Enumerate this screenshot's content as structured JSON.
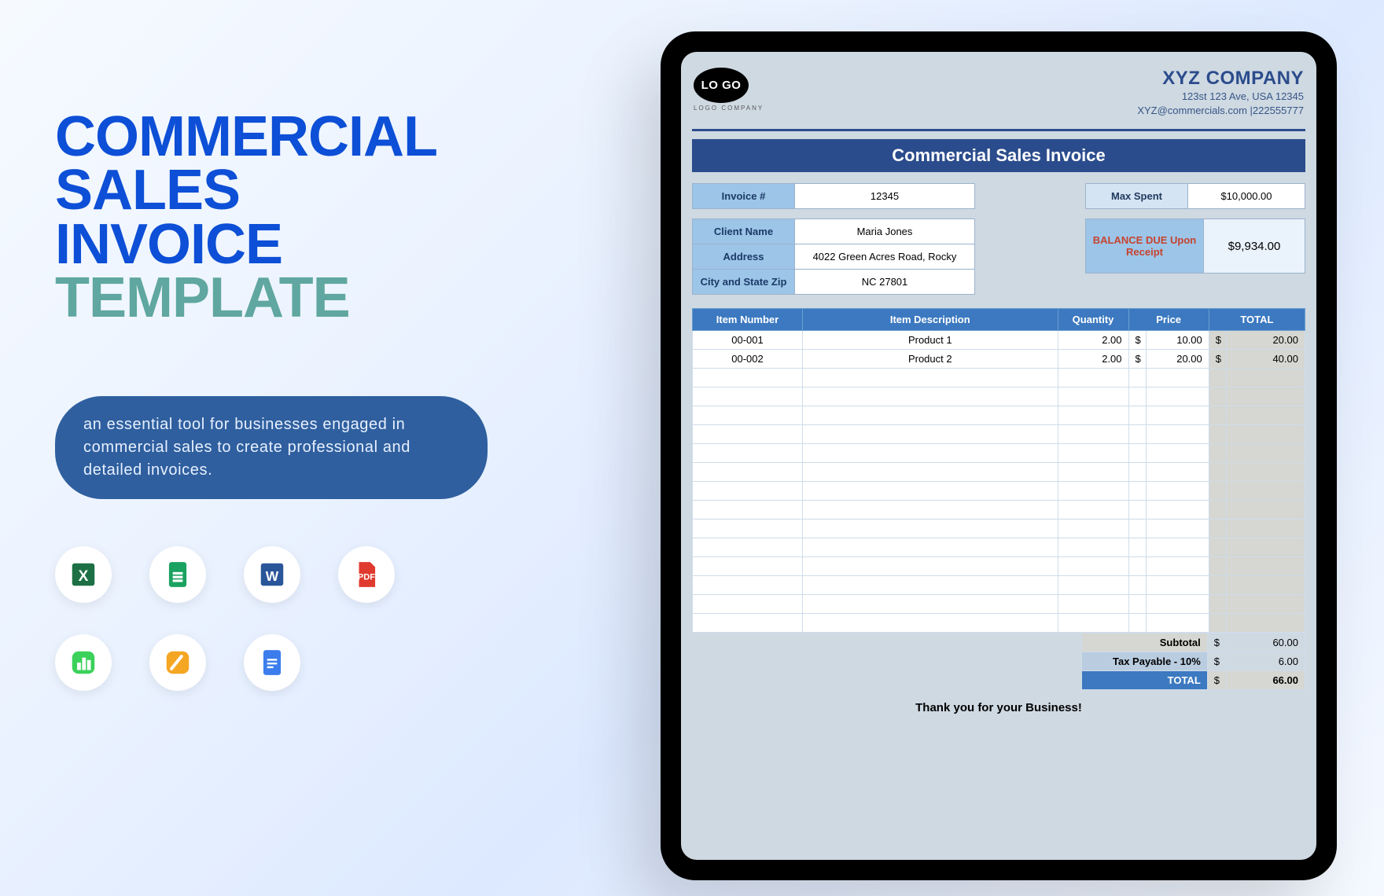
{
  "headline": {
    "l1": "COMMERCIAL",
    "l2": "SALES",
    "l3": "INVOICE",
    "l4": "TEMPLATE"
  },
  "pill_text": "an essential tool for businesses engaged in commercial sales to create professional and detailed invoices.",
  "icons": [
    "excel",
    "google-sheets",
    "word",
    "pdf",
    "apple-numbers",
    "apple-pages",
    "google-docs"
  ],
  "invoice": {
    "logo_text": "LO GO",
    "logo_sub": "LOGO COMPANY",
    "company": {
      "name": "XYZ COMPANY",
      "address": "123st 123 Ave, USA 12345",
      "contact": "XYZ@commercials.com |222555777"
    },
    "title": "Commercial Sales Invoice",
    "labels": {
      "invoice_no": "Invoice #",
      "client_name": "Client Name",
      "address": "Address",
      "city_state_zip": "City and State Zip",
      "max_spent": "Max Spent",
      "balance_due": "BALANCE DUE Upon Receipt"
    },
    "invoice_no": "12345",
    "client_name": "Maria Jones",
    "address": "4022 Green Acres Road, Rocky",
    "city_state_zip": "NC 27801",
    "max_spent": "$10,000.00",
    "balance_due": "$9,934.00",
    "columns": [
      "Item Number",
      "Item Description",
      "Quantity",
      "Price",
      "TOTAL"
    ],
    "items": [
      {
        "no": "00-001",
        "desc": "Product 1",
        "qty": "2.00",
        "price": "10.00",
        "total": "20.00"
      },
      {
        "no": "00-002",
        "desc": "Product 2",
        "qty": "2.00",
        "price": "20.00",
        "total": "40.00"
      }
    ],
    "empty_rows": 14,
    "summary": {
      "subtotal_label": "Subtotal",
      "subtotal": "60.00",
      "tax_label": "Tax Payable - 10%",
      "tax": "6.00",
      "total_label": "TOTAL",
      "total": "66.00"
    },
    "thanks": "Thank you for your Business!"
  }
}
